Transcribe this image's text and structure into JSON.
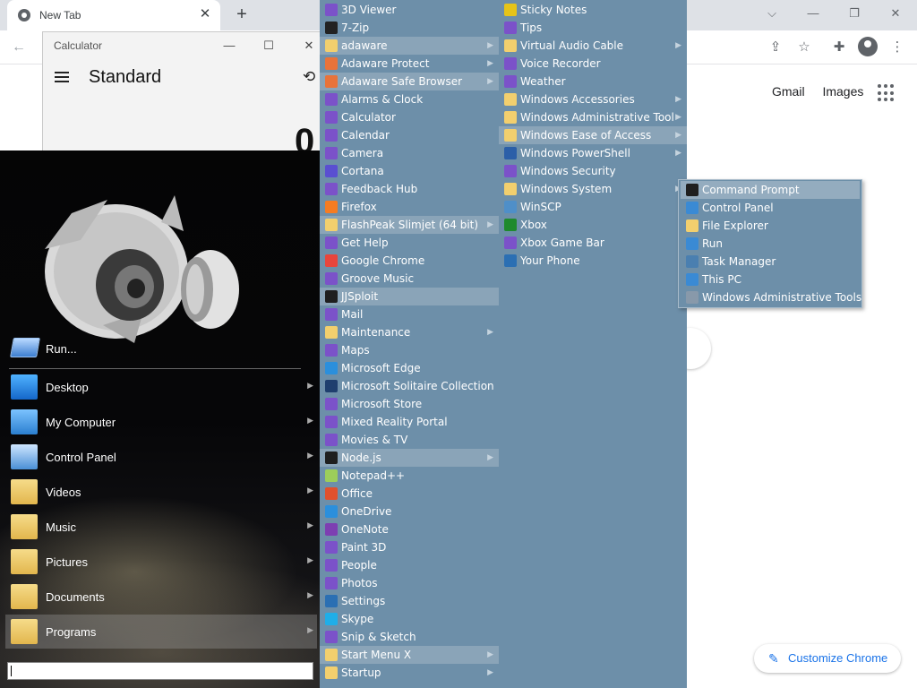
{
  "browser": {
    "tab_title": "New Tab",
    "tab_close": "✕",
    "new_tab": "+",
    "win_controls": {
      "menu": "⌵",
      "minimize": "—",
      "restore": "❐",
      "close": "✕"
    },
    "google_links": [
      "Gmail",
      "Images"
    ],
    "customize_label": "Customize Chrome"
  },
  "calculator": {
    "title": "Calculator",
    "mode": "Standard",
    "display": "0",
    "controls": {
      "minimize": "—",
      "maximize": "☐",
      "close": "✕"
    }
  },
  "start_menu": {
    "run_label": "Run...",
    "items": [
      {
        "label": "Desktop",
        "icon": "desktop-icon",
        "arrow": true
      },
      {
        "label": "My Computer",
        "icon": "computer-icon",
        "arrow": true
      },
      {
        "label": "Control Panel",
        "icon": "control-panel-icon",
        "arrow": true
      },
      {
        "label": "Videos",
        "icon": "videos-folder-icon",
        "arrow": true
      },
      {
        "label": "Music",
        "icon": "music-folder-icon",
        "arrow": true
      },
      {
        "label": "Pictures",
        "icon": "pictures-folder-icon",
        "arrow": true
      },
      {
        "label": "Documents",
        "icon": "documents-folder-icon",
        "arrow": true
      },
      {
        "label": "Programs",
        "icon": "programs-folder-icon",
        "arrow": true,
        "selected": true
      }
    ],
    "search_placeholder": ""
  },
  "programs_col1": [
    {
      "label": "3D Viewer",
      "icon": "3d-viewer-icon",
      "color": "#7b52c9"
    },
    {
      "label": "7-Zip",
      "icon": "7zip-icon",
      "color": "#222222"
    },
    {
      "label": "adaware",
      "icon": "folder-icon",
      "color": "#f2cf6e",
      "arrow": true,
      "hl": true
    },
    {
      "label": "Adaware Protect",
      "icon": "adaware-protect-icon",
      "color": "#e8733a",
      "arrow": true
    },
    {
      "label": "Adaware Safe Browser",
      "icon": "adaware-browser-icon",
      "color": "#e8733a",
      "arrow": true,
      "hl": true
    },
    {
      "label": "Alarms & Clock",
      "icon": "alarm-clock-icon",
      "color": "#7b52c9"
    },
    {
      "label": "Calculator",
      "icon": "calculator-icon",
      "color": "#7b52c9"
    },
    {
      "label": "Calendar",
      "icon": "calendar-icon",
      "color": "#7b52c9"
    },
    {
      "label": "Camera",
      "icon": "camera-icon",
      "color": "#7b52c9"
    },
    {
      "label": "Cortana",
      "icon": "cortana-icon",
      "color": "#5a4fd1"
    },
    {
      "label": "Feedback Hub",
      "icon": "feedback-hub-icon",
      "color": "#7b52c9"
    },
    {
      "label": "Firefox",
      "icon": "firefox-icon",
      "color": "#f57c22"
    },
    {
      "label": "FlashPeak Slimjet (64 bit)",
      "icon": "folder-icon",
      "color": "#f2cf6e",
      "arrow": true,
      "hl": true
    },
    {
      "label": "Get Help",
      "icon": "get-help-icon",
      "color": "#7b52c9"
    },
    {
      "label": "Google Chrome",
      "icon": "chrome-icon",
      "color": "#e8453c"
    },
    {
      "label": "Groove Music",
      "icon": "groove-music-icon",
      "color": "#7b52c9"
    },
    {
      "label": "JJSploit",
      "icon": "jjsploit-icon",
      "color": "#1f1f1f",
      "hl": true
    },
    {
      "label": "Mail",
      "icon": "mail-icon",
      "color": "#7b52c9"
    },
    {
      "label": "Maintenance",
      "icon": "folder-icon",
      "color": "#f2cf6e",
      "arrow": true
    },
    {
      "label": "Maps",
      "icon": "maps-icon",
      "color": "#7b52c9"
    },
    {
      "label": "Microsoft Edge",
      "icon": "edge-icon",
      "color": "#2b8fdc"
    },
    {
      "label": "Microsoft Solitaire Collection",
      "icon": "solitaire-icon",
      "color": "#1f3f6e"
    },
    {
      "label": "Microsoft Store",
      "icon": "store-icon",
      "color": "#7b52c9"
    },
    {
      "label": "Mixed Reality Portal",
      "icon": "mixed-reality-icon",
      "color": "#7b52c9"
    },
    {
      "label": "Movies & TV",
      "icon": "movies-icon",
      "color": "#7b52c9"
    },
    {
      "label": "Node.js",
      "icon": "nodejs-icon",
      "color": "#1f1f1f",
      "arrow": true,
      "hl": true
    },
    {
      "label": "Notepad++",
      "icon": "notepadpp-icon",
      "color": "#9ccd5a"
    },
    {
      "label": "Office",
      "icon": "office-icon",
      "color": "#e0512d"
    },
    {
      "label": "OneDrive",
      "icon": "onedrive-icon",
      "color": "#2b8fdc"
    },
    {
      "label": "OneNote",
      "icon": "onenote-icon",
      "color": "#7d3fb2"
    },
    {
      "label": "Paint 3D",
      "icon": "paint3d-icon",
      "color": "#7b52c9"
    },
    {
      "label": "People",
      "icon": "people-icon",
      "color": "#7b52c9"
    },
    {
      "label": "Photos",
      "icon": "photos-icon",
      "color": "#7b52c9"
    },
    {
      "label": "Settings",
      "icon": "settings-icon",
      "color": "#2b6fb3"
    },
    {
      "label": "Skype",
      "icon": "skype-icon",
      "color": "#1faee8"
    },
    {
      "label": "Snip & Sketch",
      "icon": "snip-sketch-icon",
      "color": "#7b52c9"
    },
    {
      "label": "Start Menu X",
      "icon": "folder-icon",
      "color": "#f2cf6e",
      "arrow": true,
      "hl": true
    },
    {
      "label": "Startup",
      "icon": "folder-icon",
      "color": "#f2cf6e",
      "arrow": true
    }
  ],
  "programs_col2": [
    {
      "label": "Sticky Notes",
      "icon": "sticky-notes-icon",
      "color": "#e6c419"
    },
    {
      "label": "Tips",
      "icon": "tips-icon",
      "color": "#7b52c9"
    },
    {
      "label": "Virtual Audio Cable",
      "icon": "folder-icon",
      "color": "#f2cf6e",
      "arrow": true
    },
    {
      "label": "Voice Recorder",
      "icon": "voice-recorder-icon",
      "color": "#7b52c9"
    },
    {
      "label": "Weather",
      "icon": "weather-icon",
      "color": "#7b52c9"
    },
    {
      "label": "Windows Accessories",
      "icon": "folder-icon",
      "color": "#f2cf6e",
      "arrow": true
    },
    {
      "label": "Windows Administrative Tool",
      "icon": "folder-icon",
      "color": "#f2cf6e",
      "arrow": true
    },
    {
      "label": "Windows Ease of Access",
      "icon": "folder-icon",
      "color": "#f2cf6e",
      "arrow": true,
      "hl": true
    },
    {
      "label": "Windows PowerShell",
      "icon": "powershell-icon",
      "color": "#2b5fa8",
      "arrow": true
    },
    {
      "label": "Windows Security",
      "icon": "windows-security-icon",
      "color": "#7b52c9"
    },
    {
      "label": "Windows System",
      "icon": "folder-icon",
      "color": "#f2cf6e",
      "arrow": true
    },
    {
      "label": "WinSCP",
      "icon": "winscp-icon",
      "color": "#4f8fc8"
    },
    {
      "label": "Xbox",
      "icon": "xbox-icon",
      "color": "#1f8a2e"
    },
    {
      "label": "Xbox Game Bar",
      "icon": "xbox-game-bar-icon",
      "color": "#7b52c9"
    },
    {
      "label": "Your Phone",
      "icon": "your-phone-icon",
      "color": "#2b6fb3"
    }
  ],
  "submenu": [
    {
      "label": "Command Prompt",
      "icon": "command-prompt-icon",
      "color": "#1f1f1f",
      "hl": true
    },
    {
      "label": "Control Panel",
      "icon": "control-panel-icon",
      "color": "#3a8ad4"
    },
    {
      "label": "File Explorer",
      "icon": "file-explorer-icon",
      "color": "#f2cf6e"
    },
    {
      "label": "Run",
      "icon": "run-icon",
      "color": "#3a8ad4"
    },
    {
      "label": "Task Manager",
      "icon": "task-manager-icon",
      "color": "#4a7fb0"
    },
    {
      "label": "This PC",
      "icon": "this-pc-icon",
      "color": "#3a8ad4"
    },
    {
      "label": "Windows Administrative Tools",
      "icon": "admin-tools-icon",
      "color": "#8899aa"
    }
  ]
}
